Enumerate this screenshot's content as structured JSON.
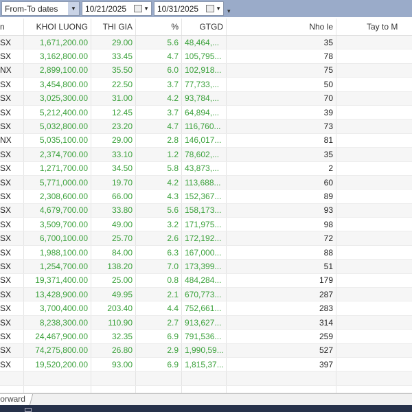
{
  "toolbar": {
    "date_mode": "From-To dates",
    "from_date": "10/21/2025",
    "to_date": "10/31/2025"
  },
  "columns": [
    "n",
    "KHOI LUONG",
    "THI GIA",
    "%",
    "GTGD",
    "Nho le",
    "Tay to M"
  ],
  "rows": [
    [
      "SX",
      "1,671,200.00",
      "29.00",
      "5.6",
      "48,464,...",
      "35"
    ],
    [
      "SX",
      "3,162,800.00",
      "33.45",
      "4.7",
      "105,795...",
      "78"
    ],
    [
      "NX",
      "2,899,100.00",
      "35.50",
      "6.0",
      "102,918...",
      "75"
    ],
    [
      "SX",
      "3,454,800.00",
      "22.50",
      "3.7",
      "77,733,...",
      "50"
    ],
    [
      "SX",
      "3,025,300.00",
      "31.00",
      "4.2",
      "93,784,...",
      "70"
    ],
    [
      "SX",
      "5,212,400.00",
      "12.45",
      "3.7",
      "64,894,...",
      "39"
    ],
    [
      "SX",
      "5,032,800.00",
      "23.20",
      "4.7",
      "116,760...",
      "73"
    ],
    [
      "NX",
      "5,035,100.00",
      "29.00",
      "2.8",
      "146,017...",
      "81"
    ],
    [
      "SX",
      "2,374,700.00",
      "33.10",
      "1.2",
      "78,602,...",
      "35"
    ],
    [
      "SX",
      "1,271,700.00",
      "34.50",
      "5.8",
      "43,873,...",
      "2"
    ],
    [
      "SX",
      "5,771,000.00",
      "19.70",
      "4.2",
      "113,688...",
      "60"
    ],
    [
      "SX",
      "2,308,600.00",
      "66.00",
      "4.3",
      "152,367...",
      "89"
    ],
    [
      "SX",
      "4,679,700.00",
      "33.80",
      "5.6",
      "158,173...",
      "93"
    ],
    [
      "SX",
      "3,509,700.00",
      "49.00",
      "3.2",
      "171,975...",
      "98"
    ],
    [
      "SX",
      "6,700,100.00",
      "25.70",
      "2.6",
      "172,192...",
      "72"
    ],
    [
      "SX",
      "1,988,100.00",
      "84.00",
      "6.3",
      "167,000...",
      "88"
    ],
    [
      "SX",
      "1,254,700.00",
      "138.20",
      "7.0",
      "173,399...",
      "51"
    ],
    [
      "SX",
      "19,371,400.00",
      "25.00",
      "0.8",
      "484,284...",
      "179"
    ],
    [
      "SX",
      "13,428,900.00",
      "49.95",
      "2.1",
      "670,773...",
      "287"
    ],
    [
      "SX",
      "3,700,400.00",
      "203.40",
      "4.4",
      "752,661...",
      "283"
    ],
    [
      "SX",
      "8,238,300.00",
      "110.90",
      "2.7",
      "913,627...",
      "314"
    ],
    [
      "SX",
      "24,467,900.00",
      "32.35",
      "6.9",
      "791,536...",
      "259"
    ],
    [
      "SX",
      "74,275,800.00",
      "26.80",
      "2.9",
      "1,990,59...",
      "527"
    ],
    [
      "SX",
      "19,520,200.00",
      "93.00",
      "6.9",
      "1,815,37...",
      "397"
    ]
  ],
  "sheet_tab": "orward"
}
